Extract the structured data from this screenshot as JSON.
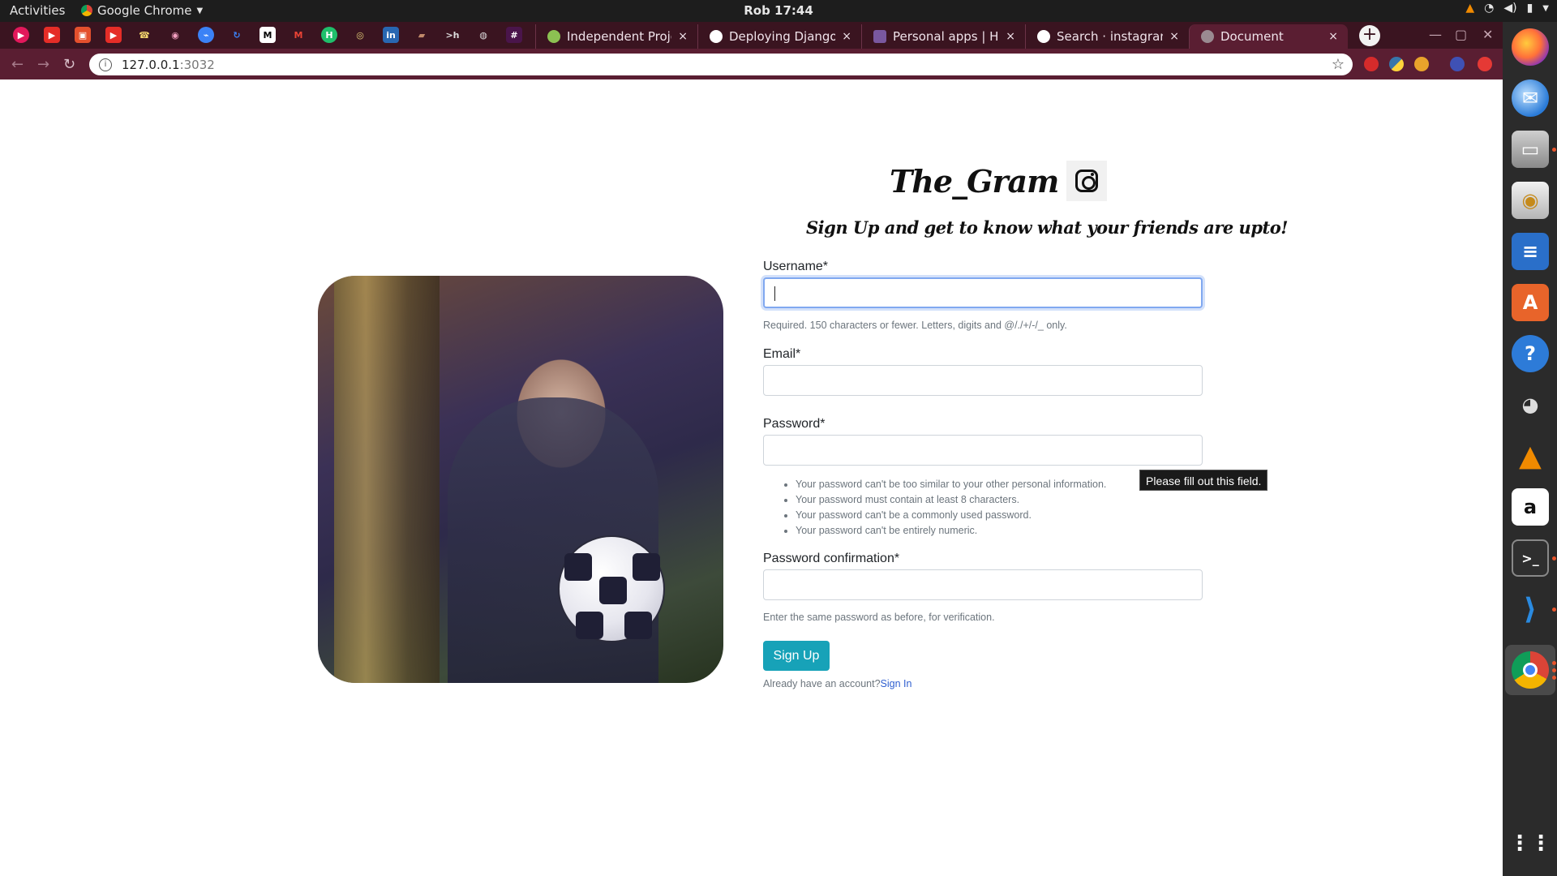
{
  "topbar": {
    "activities": "Activities",
    "app_name": "Google Chrome",
    "clock": "Rob 17:44"
  },
  "tabs": [
    {
      "title": "Independent Project"
    },
    {
      "title": "Deploying Django A"
    },
    {
      "title": "Personal apps | Hero"
    },
    {
      "title": "Search · instagram"
    },
    {
      "title": "Document"
    }
  ],
  "tab_close_glyph": "×",
  "address_bar": {
    "host": "127.0.0.1",
    "port": ":3032"
  },
  "page": {
    "brand": "The_Gram",
    "tagline": "Sign Up and get to know what your friends are upto!",
    "form": {
      "username_label": "Username*",
      "username_help": "Required. 150 characters or fewer. Letters, digits and @/./+/-/_ only.",
      "email_label": "Email*",
      "password_label": "Password*",
      "password_rules": [
        "Your password can't be too similar to your other personal information.",
        "Your password must contain at least 8 characters.",
        "Your password can't be a commonly used password.",
        "Your password can't be entirely numeric."
      ],
      "password_confirm_label": "Password confirmation*",
      "password_confirm_help": "Enter the same password as before, for verification.",
      "submit_label": "Sign Up",
      "already_text": "Already have an account?",
      "signin_link": "Sign In"
    },
    "tooltip": "Please fill out this field."
  },
  "colors": {
    "primary_button": "#17a2b8",
    "link": "#2f5fd0",
    "tab_strip": "#3a1420",
    "toolbar": "#5a1e32"
  }
}
